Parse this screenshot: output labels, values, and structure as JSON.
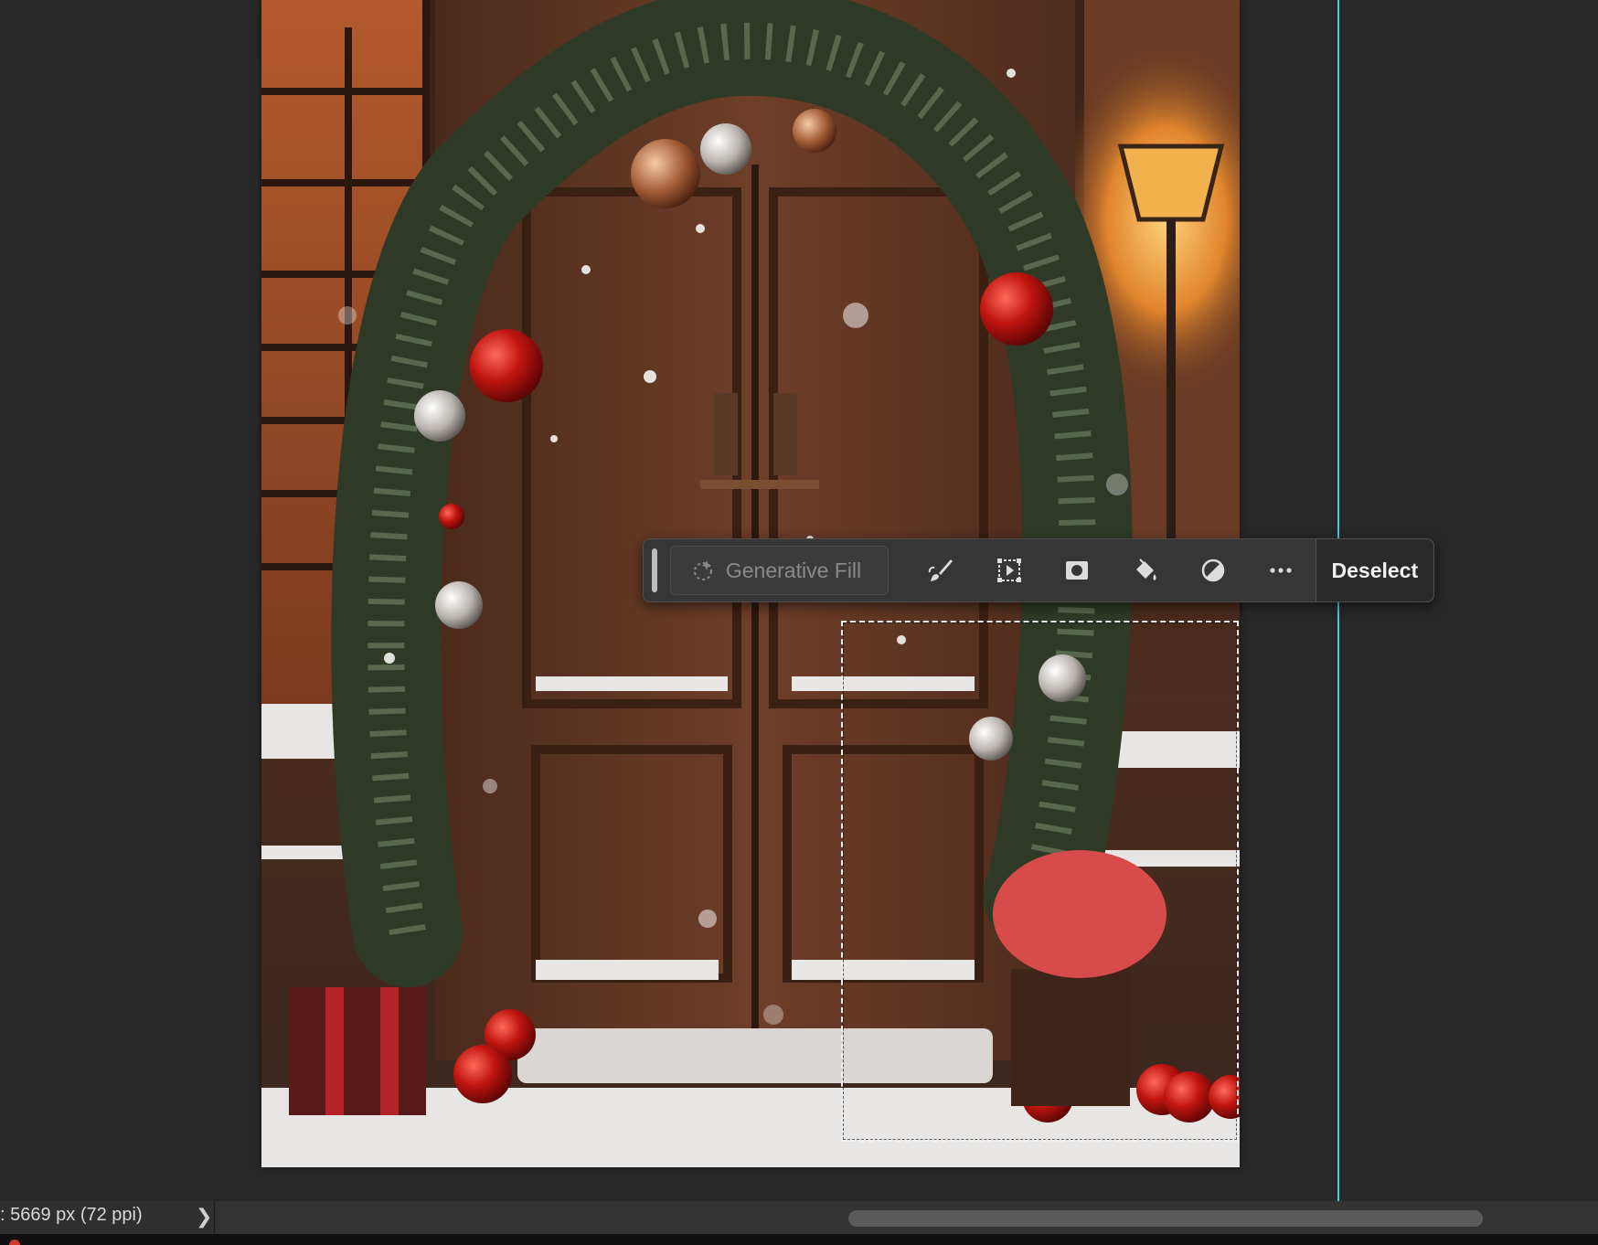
{
  "taskbar": {
    "generative_fill_label": "Generative Fill",
    "deselect_label": "Deselect",
    "tools": [
      {
        "name": "modify-selection-brush-icon"
      },
      {
        "name": "transform-selection-icon"
      },
      {
        "name": "create-mask-icon"
      },
      {
        "name": "fill-selection-icon"
      },
      {
        "name": "adjustment-layer-icon"
      },
      {
        "name": "more-options-icon"
      }
    ]
  },
  "status": {
    "document_size": ": 5669 px (72 ppi)",
    "arrow": "❯"
  },
  "colors": {
    "guide": "#3fd0d6",
    "workspace": "#282828",
    "taskbar": "#363636"
  }
}
